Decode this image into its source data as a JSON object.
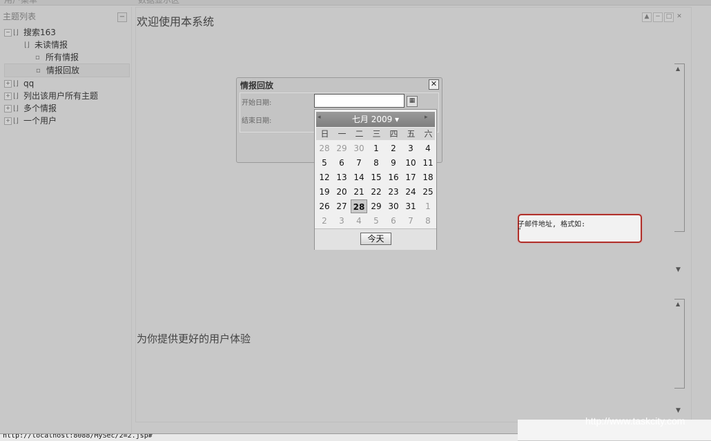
{
  "topbar": {
    "left_clip": "用户菜单",
    "right_clip": "数据显示区"
  },
  "sidebar": {
    "title": "主题列表",
    "collapse_label": "−",
    "items": [
      {
        "label": "搜索163",
        "level": 0,
        "expander": "⊟"
      },
      {
        "label": "未读情报",
        "level": 1
      },
      {
        "label": "所有情报",
        "level": 2
      },
      {
        "label": "情报回放",
        "level": 2,
        "selected": true
      },
      {
        "label": "qq",
        "level": 0,
        "expander": "⊞"
      },
      {
        "label": "列出该用户所有主题",
        "level": 0,
        "expander": "⊞"
      },
      {
        "label": "多个情报",
        "level": 0,
        "expander": "⊞"
      },
      {
        "label": "一个用户",
        "level": 0,
        "expander": "⊞"
      }
    ]
  },
  "main": {
    "welcome": "欢迎使用本系统",
    "slogan": "为你提供更好的用户体验"
  },
  "window_buttons": [
    "▲",
    "−",
    "□",
    "✕"
  ],
  "dialog": {
    "title": "情报回放",
    "close": "✕",
    "start_label": "开始日期:",
    "end_label": "结束日期:",
    "start_value": ""
  },
  "calendar": {
    "month_label": "七月 2009 ▾",
    "prev": "◂",
    "next": "▸",
    "weekdays": [
      "日",
      "一",
      "二",
      "三",
      "四",
      "五",
      "六"
    ],
    "weeks": [
      [
        "28",
        "29",
        "30",
        "1",
        "2",
        "3",
        "4"
      ],
      [
        "5",
        "6",
        "7",
        "8",
        "9",
        "10",
        "11"
      ],
      [
        "12",
        "13",
        "14",
        "15",
        "16",
        "17",
        "18"
      ],
      [
        "19",
        "20",
        "21",
        "22",
        "23",
        "24",
        "25"
      ],
      [
        "26",
        "27",
        "28",
        "29",
        "30",
        "31",
        "1"
      ],
      [
        "2",
        "3",
        "4",
        "5",
        "6",
        "7",
        "8"
      ]
    ],
    "selected_day": "28",
    "today_label": "今天"
  },
  "validation": {
    "line1": "子邮件地址, 格式如:",
    "line2": "\""
  },
  "status_bar": "http://localhost:8088/MySec/2=2.jsp#",
  "watermark": "http://www.taskcity.com"
}
